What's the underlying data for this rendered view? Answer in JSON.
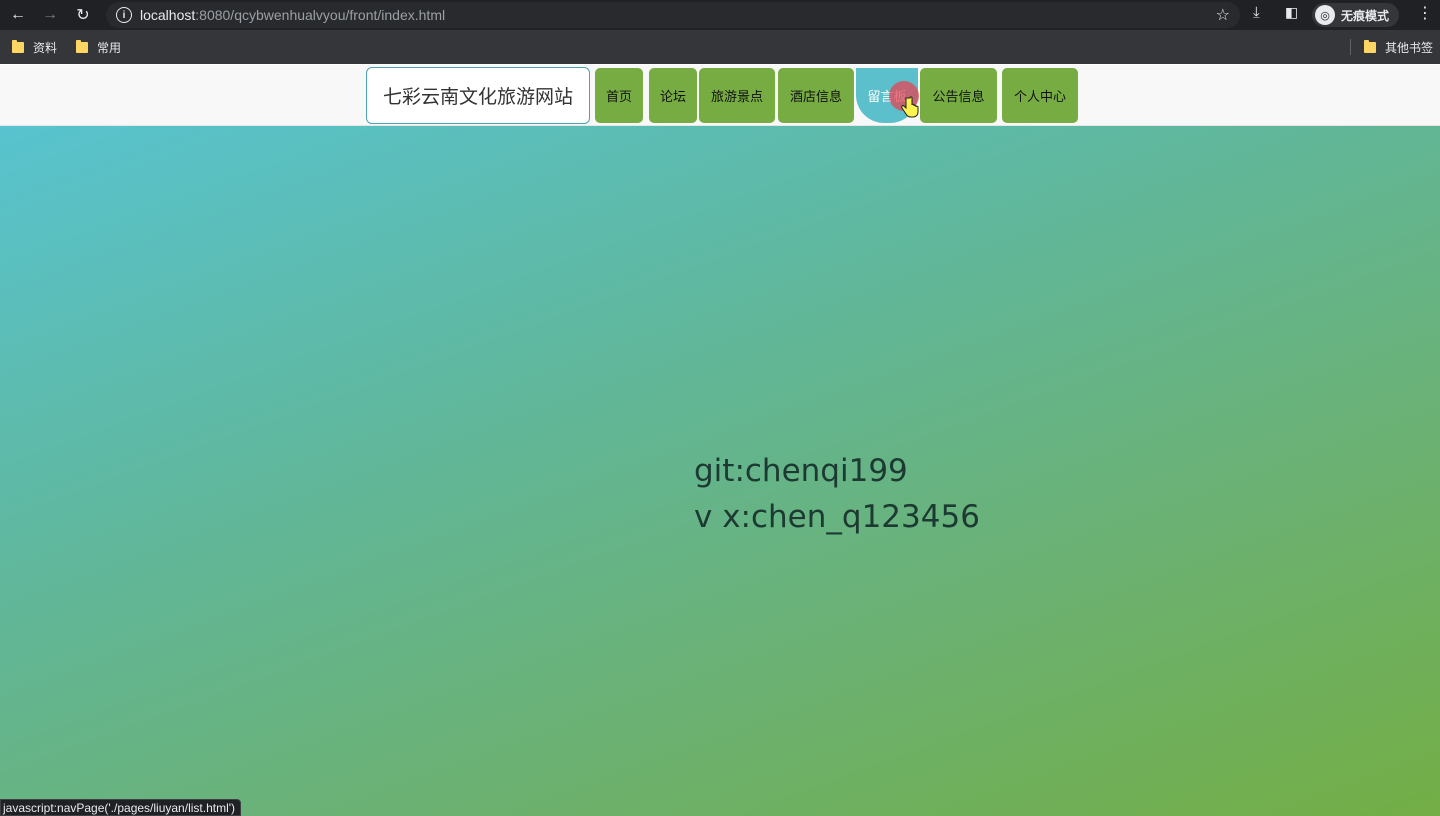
{
  "browser": {
    "url_host": "localhost",
    "url_path": ":8080/qcybwenhualvyou/front/index.html",
    "profile_label": "无痕模式",
    "bookmarks": [
      {
        "label": "资料"
      },
      {
        "label": "常用"
      }
    ],
    "other_bookmarks_label": "其他书签",
    "status_text": "javascript:navPage('./pages/liuyan/list.html')"
  },
  "site": {
    "title": "七彩云南文化旅游网站",
    "nav": [
      {
        "label": "首页"
      },
      {
        "label": "论坛"
      },
      {
        "label": "旅游景点"
      },
      {
        "label": "酒店信息"
      },
      {
        "label": "留言板",
        "active": true
      },
      {
        "label": "公告信息"
      },
      {
        "label": "个人中心"
      }
    ]
  },
  "hero": {
    "line1": "git:chenqi199",
    "line2": "v x:chen_q123456"
  }
}
